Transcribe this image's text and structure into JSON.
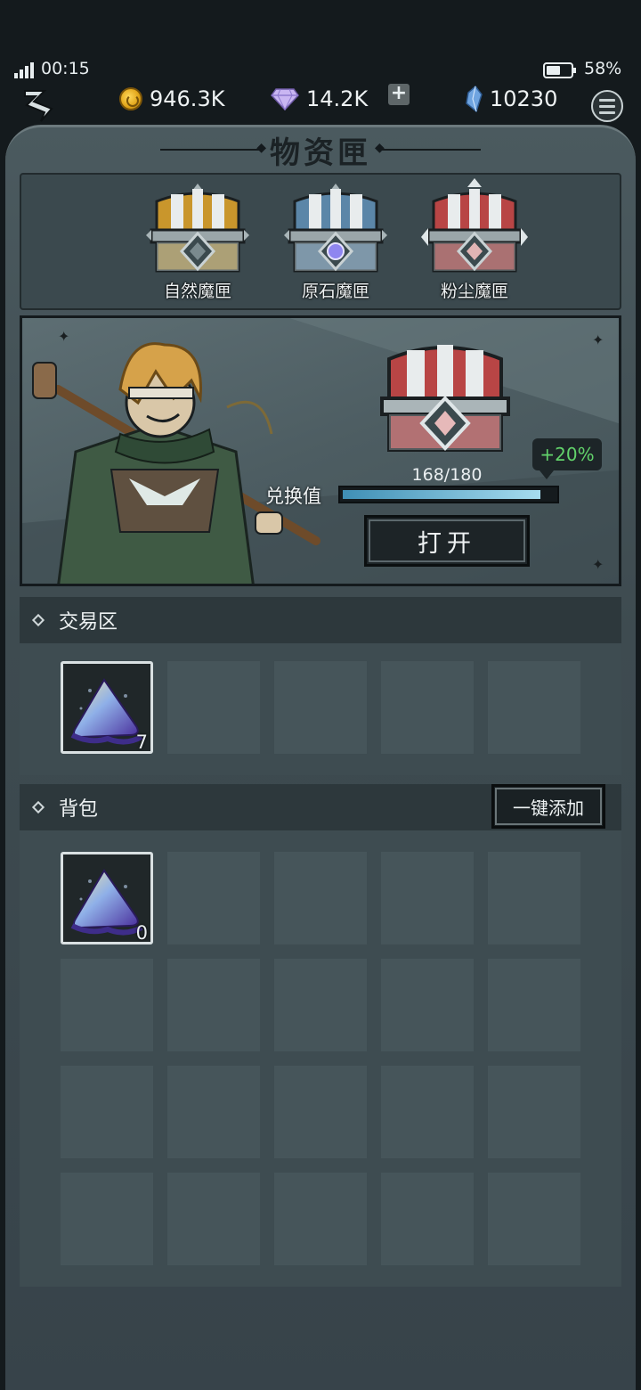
{
  "status_bar": {
    "time": "00:15",
    "battery": "58%",
    "battery_level": 0.58
  },
  "currencies": {
    "gold": "946.3K",
    "diamond": "14.2K",
    "crystal": "10230"
  },
  "title": "物资匣",
  "chests": [
    {
      "name": "自然魔匣",
      "color": "#c9962c"
    },
    {
      "name": "原石魔匣",
      "color": "#5b86a8"
    },
    {
      "name": "粉尘魔匣",
      "color": "#b84545",
      "selected": true
    }
  ],
  "banner": {
    "progress_text": "168/180",
    "progress_current": 168,
    "progress_max": 180,
    "exchange_label": "兑换值",
    "bonus": "+20%",
    "open_button": "打开"
  },
  "trade_area": {
    "label": "交易区",
    "items": [
      {
        "icon": "dust-pile-icon",
        "count": "7"
      }
    ],
    "empty_slots": 4
  },
  "backpack": {
    "label": "背包",
    "add_all_button": "一键添加",
    "items": [
      {
        "icon": "dust-pile-icon",
        "count": "0"
      }
    ],
    "empty_slots": 19
  }
}
